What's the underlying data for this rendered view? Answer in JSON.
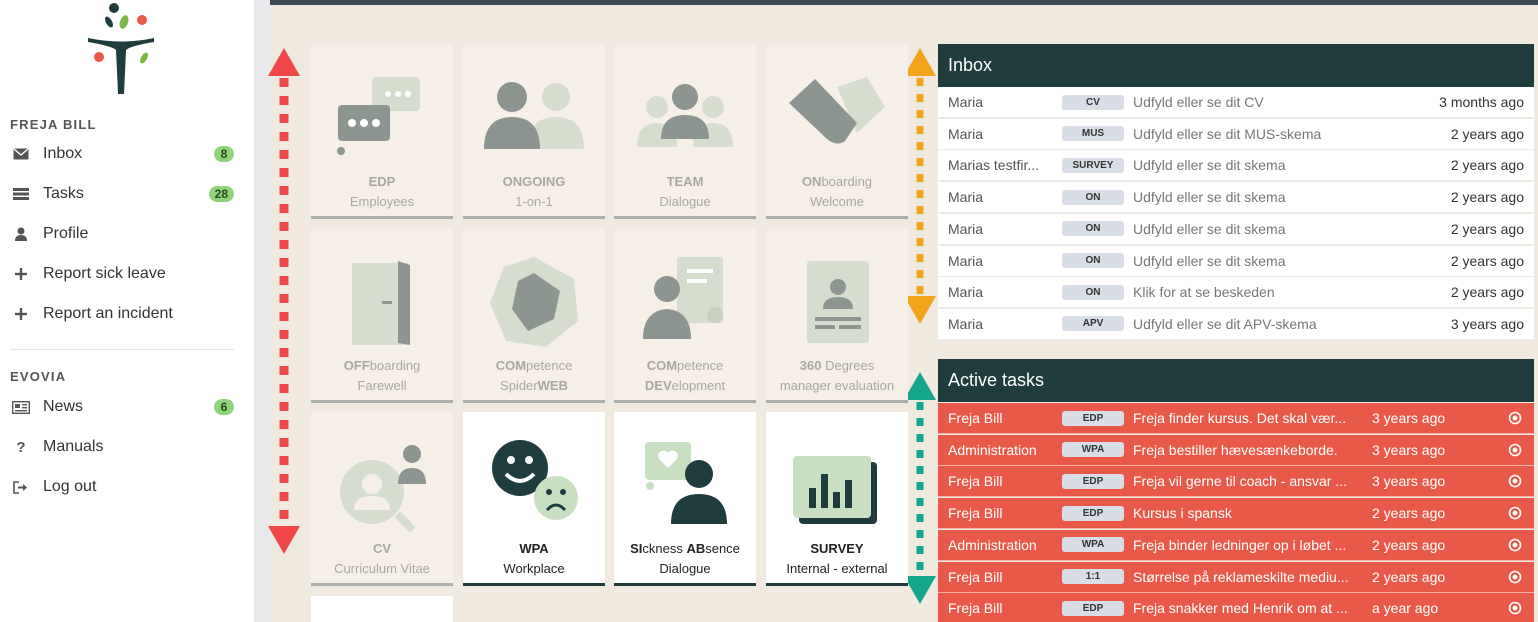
{
  "sidebar": {
    "user_section": "FREJA BILL",
    "user_items": [
      {
        "label": "Inbox",
        "icon": "envelope-icon",
        "badge": "8"
      },
      {
        "label": "Tasks",
        "icon": "list-icon",
        "badge": "28"
      },
      {
        "label": "Profile",
        "icon": "user-icon",
        "badge": null
      },
      {
        "label": "Report sick leave",
        "icon": "plus-icon",
        "badge": null
      },
      {
        "label": "Report an incident",
        "icon": "plus-icon",
        "badge": null
      }
    ],
    "org_section": "EVOVIA",
    "org_items": [
      {
        "label": "News",
        "icon": "newspaper-icon",
        "badge": "6"
      },
      {
        "label": "Manuals",
        "icon": "question-icon",
        "badge": null
      },
      {
        "label": "Log out",
        "icon": "logout-icon",
        "badge": null
      }
    ]
  },
  "tiles": [
    {
      "bold1": "EDP",
      "rest1": "",
      "line2": "Employees",
      "active": false
    },
    {
      "bold1": "ONGOING",
      "rest1": "",
      "line2": "1-on-1",
      "active": false
    },
    {
      "bold1": "TEAM",
      "rest1": "",
      "line2": "Dialogue",
      "active": false
    },
    {
      "bold1": "ON",
      "rest1": "boarding",
      "line2": "Welcome",
      "active": false
    },
    {
      "bold1": "OFF",
      "rest1": "boarding",
      "line2": "Farewell",
      "active": false
    },
    {
      "bold1": "COM",
      "rest1": "petence",
      "line2a": "Spider",
      "line2b": "WEB",
      "active": false
    },
    {
      "bold1": "COM",
      "rest1": "petence",
      "line2a": "DEV",
      "line2b": "elopment",
      "active": false
    },
    {
      "bold1": "360",
      "rest1": " Degrees",
      "line2": "manager evaluation",
      "active": false
    },
    {
      "bold1": "CV",
      "rest1": "",
      "line2": "Curriculum Vitae",
      "active": false
    },
    {
      "bold1": "WPA",
      "rest1": "",
      "line2": "Workplace",
      "active": true
    },
    {
      "bold1a": "SI",
      "rest1a": "ckness ",
      "bold1b": "AB",
      "rest1b": "sence",
      "line2": "Dialogue",
      "active": true
    },
    {
      "bold1": "SURVEY",
      "rest1": "",
      "line2": "Internal - external",
      "active": true
    }
  ],
  "inbox": {
    "title": "Inbox",
    "rows": [
      {
        "name": "Maria",
        "tag": "CV",
        "msg": "Udfyld eller se dit CV",
        "when": "3 months ago"
      },
      {
        "name": "Maria",
        "tag": "MUS",
        "msg": "Udfyld eller se dit MUS-skema",
        "when": "2 years ago"
      },
      {
        "name": "Marias testfir...",
        "tag": "SURVEY",
        "msg": "Udfyld eller se dit skema",
        "when": "2 years ago"
      },
      {
        "name": "Maria",
        "tag": "ON",
        "msg": "Udfyld eller se dit skema",
        "when": "2 years ago"
      },
      {
        "name": "Maria",
        "tag": "ON",
        "msg": "Udfyld eller se dit skema",
        "when": "2 years ago"
      },
      {
        "name": "Maria",
        "tag": "ON",
        "msg": "Udfyld eller se dit skema",
        "when": "2 years ago"
      },
      {
        "name": "Maria",
        "tag": "ON",
        "msg": "Klik for at se beskeden",
        "when": "2 years ago"
      },
      {
        "name": "Maria",
        "tag": "APV",
        "msg": "Udfyld eller se dit APV-skema",
        "when": "3 years ago"
      }
    ]
  },
  "tasks": {
    "title": "Active tasks",
    "rows": [
      {
        "name": "Freja Bill",
        "tag": "EDP",
        "msg": "Freja finder kursus. Det skal vær...",
        "when": "3 years ago"
      },
      {
        "name": "Administration",
        "tag": "WPA",
        "msg": "Freja bestiller hævesænkeborde.",
        "when": "3 years ago"
      },
      {
        "name": "Freja Bill",
        "tag": "EDP",
        "msg": "Freja vil gerne til coach - ansvar ...",
        "when": "3 years ago"
      },
      {
        "name": "Freja Bill",
        "tag": "EDP",
        "msg": "Kursus i spansk",
        "when": "2 years ago"
      },
      {
        "name": "Administration",
        "tag": "WPA",
        "msg": "Freja binder ledninger op i løbet ...",
        "when": "2 years ago"
      },
      {
        "name": "Freja Bill",
        "tag": "1:1",
        "msg": "Størrelse på reklameskilte mediu...",
        "when": "2 years ago"
      },
      {
        "name": "Freja Bill",
        "tag": "EDP",
        "msg": "Freja snakker med Henrik om at ...",
        "when": "a year ago"
      }
    ]
  },
  "colors": {
    "panel_header": "#1f3d3d",
    "task_row": "#e8594a",
    "badge": "#8fd47a",
    "arrow_red": "#f04848",
    "arrow_orange": "#f2a51a",
    "arrow_teal": "#14a58b"
  }
}
